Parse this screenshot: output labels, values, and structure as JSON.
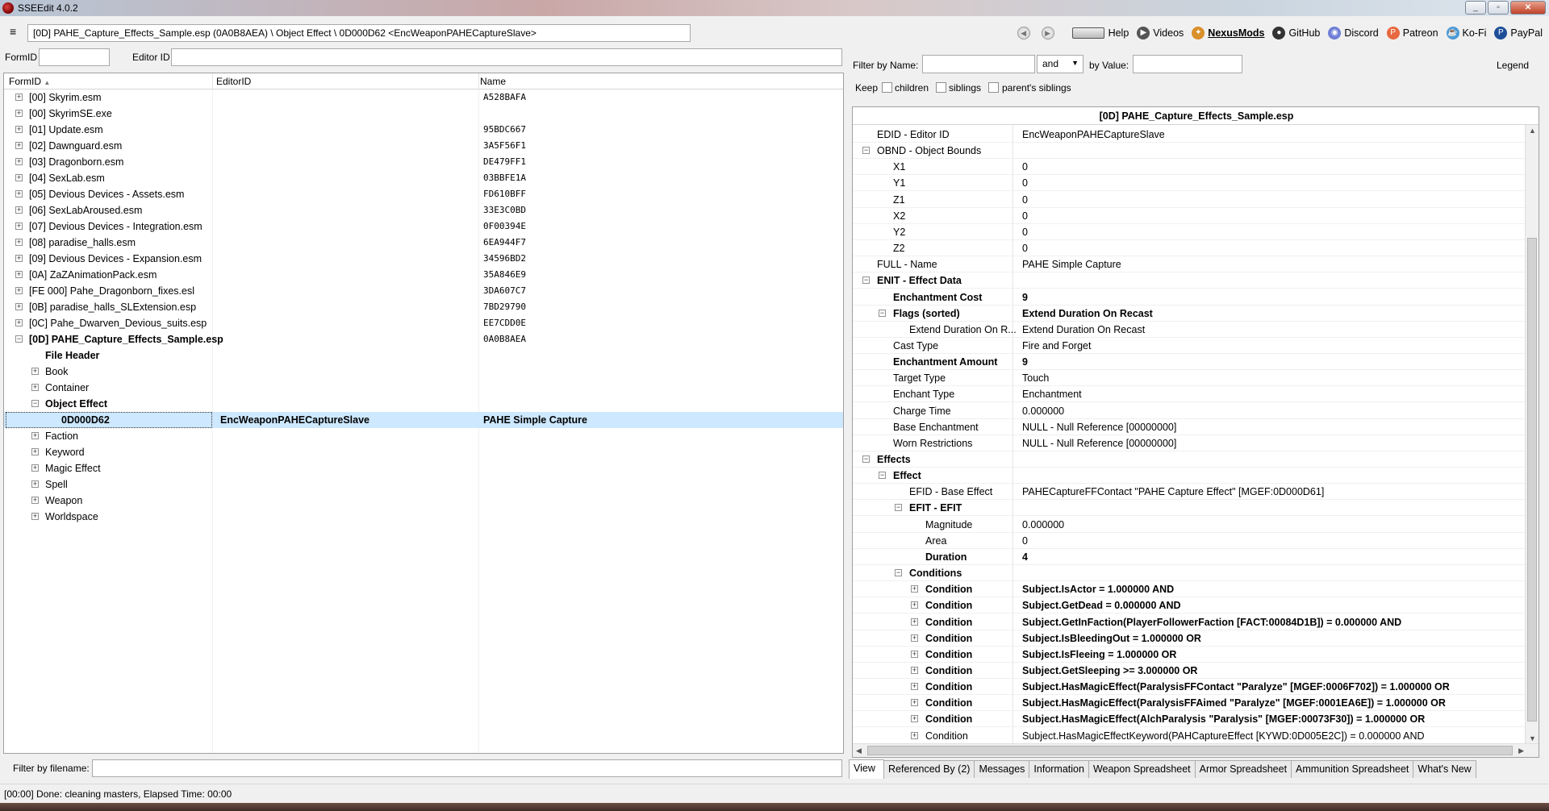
{
  "window": {
    "title": "SSEEdit 4.0.2"
  },
  "path_bar": {
    "value": "[0D] PAHE_Capture_Effects_Sample.esp (0A0B8AEA) \\ Object Effect \\ 0D000D62 <EncWeaponPAHECaptureSlave>"
  },
  "top_links": [
    {
      "label": "Help",
      "icon": "book-icon"
    },
    {
      "label": "Videos",
      "icon": "videos-icon"
    },
    {
      "label": "NexusMods",
      "icon": "nexusmods-icon"
    },
    {
      "label": "GitHub",
      "icon": "github-icon"
    },
    {
      "label": "Discord",
      "icon": "discord-icon"
    },
    {
      "label": "Patreon",
      "icon": "patreon-icon"
    },
    {
      "label": "Ko-Fi",
      "icon": "kofi-icon"
    },
    {
      "label": "PayPal",
      "icon": "paypal-icon"
    }
  ],
  "left_filter": {
    "formid_label": "FormID",
    "editorid_label": "Editor ID"
  },
  "left_columns": {
    "formid": "FormID",
    "editorid": "EditorID",
    "name": "Name"
  },
  "tree": [
    {
      "label": "[00] Skyrim.esm",
      "name": "A528BAFA",
      "level": 0,
      "exp": "+"
    },
    {
      "label": "[00] SkyrimSE.exe",
      "name": "",
      "level": 0,
      "exp": "+"
    },
    {
      "label": "[01] Update.esm",
      "name": "95BDC667",
      "level": 0,
      "exp": "+"
    },
    {
      "label": "[02] Dawnguard.esm",
      "name": "3A5F56F1",
      "level": 0,
      "exp": "+"
    },
    {
      "label": "[03] Dragonborn.esm",
      "name": "DE479FF1",
      "level": 0,
      "exp": "+"
    },
    {
      "label": "[04] SexLab.esm",
      "name": "03BBFE1A",
      "level": 0,
      "exp": "+"
    },
    {
      "label": "[05] Devious Devices - Assets.esm",
      "name": "FD610BFF",
      "level": 0,
      "exp": "+"
    },
    {
      "label": "[06] SexLabAroused.esm",
      "name": "33E3C0BD",
      "level": 0,
      "exp": "+"
    },
    {
      "label": "[07] Devious Devices - Integration.esm",
      "name": "0F00394E",
      "level": 0,
      "exp": "+"
    },
    {
      "label": "[08] paradise_halls.esm",
      "name": "6EA944F7",
      "level": 0,
      "exp": "+"
    },
    {
      "label": "[09] Devious Devices - Expansion.esm",
      "name": "34596BD2",
      "level": 0,
      "exp": "+"
    },
    {
      "label": "[0A] ZaZAnimationPack.esm",
      "name": "35A846E9",
      "level": 0,
      "exp": "+"
    },
    {
      "label": "[FE 000] Pahe_Dragonborn_fixes.esl",
      "name": "3DA607C7",
      "level": 0,
      "exp": "+"
    },
    {
      "label": "[0B] paradise_halls_SLExtension.esp",
      "name": "7BD29790",
      "level": 0,
      "exp": "+"
    },
    {
      "label": "[0C] Pahe_Dwarven_Devious_suits.esp",
      "name": "EE7CDD0E",
      "level": 0,
      "exp": "+"
    },
    {
      "label": "[0D] PAHE_Capture_Effects_Sample.esp",
      "name": "0A0B8AEA",
      "level": 0,
      "exp": "-",
      "bold": true
    },
    {
      "label": "File Header",
      "name": "",
      "level": 1,
      "exp": "",
      "bold": true
    },
    {
      "label": "Book",
      "name": "",
      "level": 1,
      "exp": "+"
    },
    {
      "label": "Container",
      "name": "",
      "level": 1,
      "exp": "+"
    },
    {
      "label": "Object Effect",
      "name": "",
      "level": 1,
      "exp": "-",
      "bold": true
    },
    {
      "label": "0D000D62",
      "editorid": "EncWeaponPAHECaptureSlave",
      "name": "PAHE Simple Capture",
      "level": 2,
      "exp": "",
      "selected": true
    },
    {
      "label": "Faction",
      "name": "",
      "level": 1,
      "exp": "+"
    },
    {
      "label": "Keyword",
      "name": "",
      "level": 1,
      "exp": "+"
    },
    {
      "label": "Magic Effect",
      "name": "",
      "level": 1,
      "exp": "+"
    },
    {
      "label": "Spell",
      "name": "",
      "level": 1,
      "exp": "+"
    },
    {
      "label": "Weapon",
      "name": "",
      "level": 1,
      "exp": "+"
    },
    {
      "label": "Worldspace",
      "name": "",
      "level": 1,
      "exp": "+"
    }
  ],
  "filename_filter": {
    "label": "Filter by filename:"
  },
  "right_filter": {
    "by_name_label": "Filter by Name:",
    "operator": "and",
    "by_value_label": "by Value:",
    "legend_label": "Legend",
    "keep_label": "Keep",
    "children_label": "children",
    "siblings_label": "siblings",
    "parent_siblings_label": "parent's siblings"
  },
  "record": {
    "header": "[0D] PAHE_Capture_Effects_Sample.esp",
    "rows": [
      {
        "k": "EDID - Editor ID",
        "v": "EncWeaponPAHECaptureSlave",
        "lvl": 0
      },
      {
        "k": "OBND - Object Bounds",
        "v": "",
        "lvl": 0,
        "exp": "-"
      },
      {
        "k": "X1",
        "v": "0",
        "lvl": 1
      },
      {
        "k": "Y1",
        "v": "0",
        "lvl": 1
      },
      {
        "k": "Z1",
        "v": "0",
        "lvl": 1
      },
      {
        "k": "X2",
        "v": "0",
        "lvl": 1
      },
      {
        "k": "Y2",
        "v": "0",
        "lvl": 1
      },
      {
        "k": "Z2",
        "v": "0",
        "lvl": 1
      },
      {
        "k": "FULL - Name",
        "v": "PAHE Simple Capture",
        "lvl": 0
      },
      {
        "k": "ENIT - Effect Data",
        "v": "",
        "lvl": 0,
        "exp": "-",
        "bold": true
      },
      {
        "k": "Enchantment Cost",
        "v": "9",
        "lvl": 1,
        "bold": true,
        "vbold": true
      },
      {
        "k": "Flags (sorted)",
        "v": "Extend Duration On Recast",
        "lvl": 1,
        "exp": "-",
        "bold": true,
        "vbold": true
      },
      {
        "k": "Extend Duration On R...",
        "v": "Extend Duration On Recast",
        "lvl": 2
      },
      {
        "k": "Cast Type",
        "v": "Fire and Forget",
        "lvl": 1
      },
      {
        "k": "Enchantment Amount",
        "v": "9",
        "lvl": 1,
        "bold": true,
        "vbold": true
      },
      {
        "k": "Target Type",
        "v": "Touch",
        "lvl": 1
      },
      {
        "k": "Enchant Type",
        "v": "Enchantment",
        "lvl": 1
      },
      {
        "k": "Charge Time",
        "v": "0.000000",
        "lvl": 1
      },
      {
        "k": "Base Enchantment",
        "v": "NULL - Null Reference [00000000]",
        "lvl": 1
      },
      {
        "k": "Worn Restrictions",
        "v": "NULL - Null Reference [00000000]",
        "lvl": 1
      },
      {
        "k": "Effects",
        "v": "",
        "lvl": 0,
        "exp": "-",
        "bold": true
      },
      {
        "k": "Effect",
        "v": "",
        "lvl": 1,
        "exp": "-",
        "bold": true
      },
      {
        "k": "EFID - Base Effect",
        "v": "PAHECaptureFFContact \"PAHE Capture Effect\" [MGEF:0D000D61]",
        "lvl": 2
      },
      {
        "k": "EFIT - EFIT",
        "v": "",
        "lvl": 2,
        "exp": "-",
        "bold": true
      },
      {
        "k": "Magnitude",
        "v": "0.000000",
        "lvl": 3
      },
      {
        "k": "Area",
        "v": "0",
        "lvl": 3
      },
      {
        "k": "Duration",
        "v": "4",
        "lvl": 3,
        "bold": true,
        "vbold": true
      },
      {
        "k": "Conditions",
        "v": "",
        "lvl": 2,
        "exp": "-",
        "bold": true
      },
      {
        "k": "Condition",
        "v": "Subject.IsActor = 1.000000 AND",
        "lvl": 3,
        "exp": "+",
        "bold": true,
        "vbold": true
      },
      {
        "k": "Condition",
        "v": "Subject.GetDead = 0.000000 AND",
        "lvl": 3,
        "exp": "+",
        "bold": true,
        "vbold": true
      },
      {
        "k": "Condition",
        "v": "Subject.GetInFaction(PlayerFollowerFaction [FACT:00084D1B]) = 0.000000 AND",
        "lvl": 3,
        "exp": "+",
        "bold": true,
        "vbold": true
      },
      {
        "k": "Condition",
        "v": "Subject.IsBleedingOut = 1.000000 OR",
        "lvl": 3,
        "exp": "+",
        "bold": true,
        "vbold": true
      },
      {
        "k": "Condition",
        "v": "Subject.IsFleeing = 1.000000 OR",
        "lvl": 3,
        "exp": "+",
        "bold": true,
        "vbold": true
      },
      {
        "k": "Condition",
        "v": "Subject.GetSleeping >= 3.000000 OR",
        "lvl": 3,
        "exp": "+",
        "bold": true,
        "vbold": true
      },
      {
        "k": "Condition",
        "v": "Subject.HasMagicEffect(ParalysisFFContact \"Paralyze\" [MGEF:0006F702]) = 1.000000 OR",
        "lvl": 3,
        "exp": "+",
        "bold": true,
        "vbold": true
      },
      {
        "k": "Condition",
        "v": "Subject.HasMagicEffect(ParalysisFFAimed \"Paralyze\" [MGEF:0001EA6E]) = 1.000000 OR",
        "lvl": 3,
        "exp": "+",
        "bold": true,
        "vbold": true
      },
      {
        "k": "Condition",
        "v": "Subject.HasMagicEffect(AlchParalysis \"Paralysis\" [MGEF:00073F30]) = 1.000000 OR",
        "lvl": 3,
        "exp": "+",
        "bold": true,
        "vbold": true
      },
      {
        "k": "Condition",
        "v": "Subject.HasMagicEffectKeyword(PAHCaptureEffect [KYWD:0D005E2C]) = 0.000000 AND",
        "lvl": 3,
        "exp": "+"
      }
    ]
  },
  "tabs": [
    {
      "label": "View",
      "active": true
    },
    {
      "label": "Referenced By (2)"
    },
    {
      "label": "Messages"
    },
    {
      "label": "Information"
    },
    {
      "label": "Weapon Spreadsheet"
    },
    {
      "label": "Armor Spreadsheet"
    },
    {
      "label": "Ammunition Spreadsheet"
    },
    {
      "label": "What's New"
    }
  ],
  "status": {
    "text": "[00:00] Done: cleaning masters, Elapsed Time: 00:00"
  }
}
